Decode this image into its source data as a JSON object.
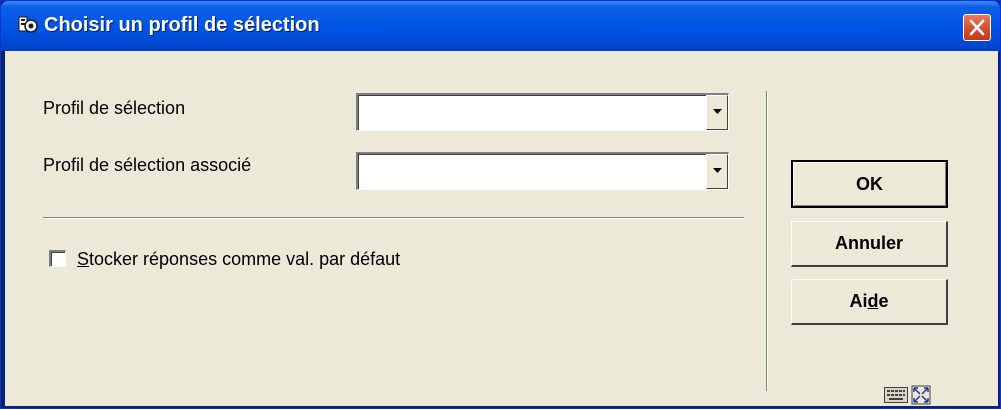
{
  "window": {
    "title": "Choisir un profil de sélection"
  },
  "form": {
    "selection_profile_label": "Profil de sélection",
    "selection_profile_value": "",
    "associated_profile_label": "Profil de sélection associé",
    "associated_profile_value": "",
    "store_defaults_label_mnemonic": "S",
    "store_defaults_label_rest": "tocker réponses comme val. par défaut",
    "store_defaults_checked": false
  },
  "buttons": {
    "ok_label": "OK",
    "cancel_label": "Annuler",
    "help_label_before": "Ai",
    "help_label_mnemonic": "d",
    "help_label_after": "e"
  },
  "icons": {
    "app": "app-icon",
    "close": "close-icon",
    "keyboard": "keyboard-icon",
    "resize": "resize-icon"
  }
}
